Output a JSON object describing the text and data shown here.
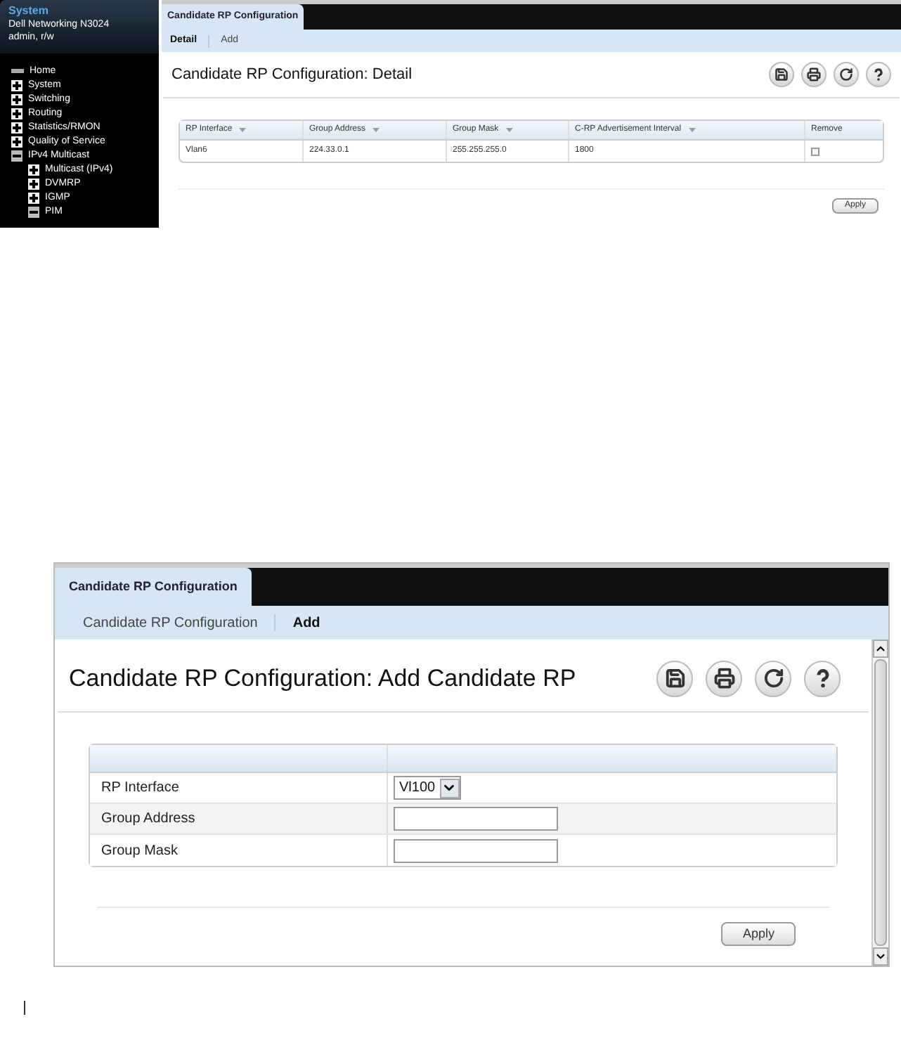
{
  "detail_screen": {
    "sidebar": {
      "title": "System",
      "device": "Dell Networking N3024",
      "user": "admin, r/w",
      "items": [
        {
          "label": "Home",
          "kind": "leaf"
        },
        {
          "label": "System",
          "kind": "folder",
          "expanded": false
        },
        {
          "label": "Switching",
          "kind": "folder",
          "expanded": false
        },
        {
          "label": "Routing",
          "kind": "folder",
          "expanded": false
        },
        {
          "label": "Statistics/RMON",
          "kind": "folder",
          "expanded": false
        },
        {
          "label": "Quality of Service",
          "kind": "folder",
          "expanded": false
        },
        {
          "label": "IPv4 Multicast",
          "kind": "folder",
          "expanded": true,
          "children": [
            {
              "label": "Multicast (IPv4)",
              "kind": "folder",
              "expanded": false
            },
            {
              "label": "DVMRP",
              "kind": "folder",
              "expanded": false
            },
            {
              "label": "IGMP",
              "kind": "folder",
              "expanded": false
            },
            {
              "label": "PIM",
              "kind": "folder",
              "expanded": true
            }
          ]
        }
      ]
    },
    "tab": "Candidate RP Configuration",
    "subtabs": [
      {
        "label": "Detail",
        "selected": true
      },
      {
        "label": "Add",
        "selected": false
      }
    ],
    "title": "Candidate RP Configuration: Detail",
    "table": {
      "columns": [
        "RP Interface",
        "Group Address",
        "Group Mask",
        "C-RP Advertisement Interval",
        "Remove"
      ],
      "rows": [
        {
          "cells": [
            "Vlan6",
            "224.33.0.1",
            "255.255.255.0",
            "1800"
          ],
          "remove": false
        }
      ]
    },
    "apply": "Apply"
  },
  "add_screen": {
    "tab": "Candidate RP Configuration",
    "subtabs": [
      {
        "label": "Candidate RP Configuration",
        "selected": false
      },
      {
        "label": "Add",
        "selected": true
      }
    ],
    "title": "Candidate RP Configuration: Add Candidate RP",
    "form": [
      {
        "label": "RP Interface",
        "kind": "select",
        "value": "Vl100"
      },
      {
        "label": "Group Address",
        "kind": "text"
      },
      {
        "label": "Group Mask",
        "kind": "text"
      }
    ],
    "apply": "Apply"
  }
}
